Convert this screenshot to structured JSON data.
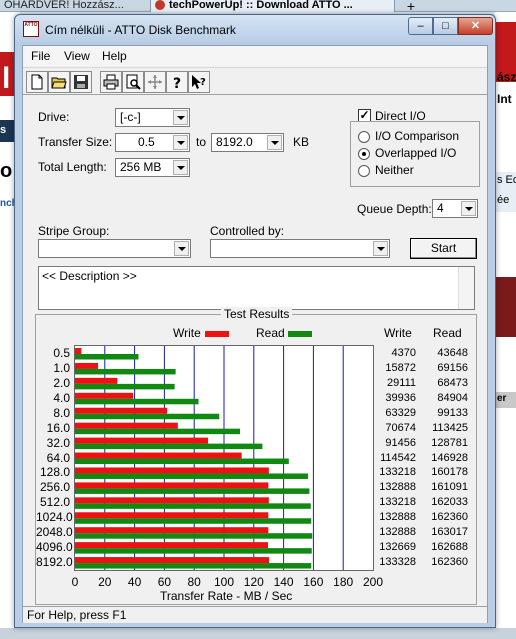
{
  "browser": {
    "tab1": "OHARDVER! Hozzász...",
    "tab2": "techPowerUp! :: Download ATTO ...",
    "tab2_close": "×",
    "new_tab": "+",
    "left_fragments": [
      "l",
      "s",
      "o",
      "nch"
    ],
    "right_fragments": [
      "ász",
      "Int",
      "s Ed",
      "ée",
      "er"
    ]
  },
  "window": {
    "title": "Cím nélküli - ATTO Disk Benchmark",
    "icon_text": "ATTO",
    "min": "–",
    "max": "□",
    "close": "✕"
  },
  "menu": [
    "File",
    "View",
    "Help"
  ],
  "toolbar": [
    "new-icon",
    "open-icon",
    "save-icon",
    "print-icon",
    "print-preview-icon",
    "move-icon",
    "help-icon",
    "context-help-icon"
  ],
  "form": {
    "drive_label": "Drive:",
    "drive_value": "[-c-]",
    "transfer_label": "Transfer Size:",
    "transfer_from": "0.5",
    "to_label": "to",
    "transfer_to": "8192.0",
    "kb_label": "KB",
    "length_label": "Total Length:",
    "length_value": "256 MB",
    "direct_io_label": "Direct I/O",
    "direct_io_checked": true,
    "radio_io_comparison": "I/O Comparison",
    "radio_overlapped": "Overlapped I/O",
    "radio_neither": "Neither",
    "radio_selected": "Overlapped I/O",
    "queue_label": "Queue Depth:",
    "queue_value": "4",
    "stripe_label": "Stripe Group:",
    "controlled_label": "Controlled by:",
    "start_label": "Start",
    "description": "<< Description >>"
  },
  "results": {
    "title": "Test Results",
    "write_label": "Write",
    "read_label": "Read",
    "col_write": "Write",
    "col_read": "Read",
    "xlabel": "Transfer Rate - MB / Sec",
    "write_color": "#ee1111",
    "read_color": "#118811"
  },
  "chart_data": {
    "type": "bar",
    "orientation": "horizontal",
    "categories": [
      "0.5",
      "1.0",
      "2.0",
      "4.0",
      "8.0",
      "16.0",
      "32.0",
      "64.0",
      "128.0",
      "256.0",
      "512.0",
      "1024.0",
      "2048.0",
      "4096.0",
      "8192.0"
    ],
    "series": [
      {
        "name": "Write",
        "values": [
          4370,
          15872,
          29111,
          39936,
          63329,
          70674,
          91456,
          114542,
          133218,
          132888,
          133218,
          132888,
          132888,
          132669,
          133328
        ]
      },
      {
        "name": "Read",
        "values": [
          43648,
          69156,
          68473,
          84904,
          99133,
          113425,
          128781,
          146928,
          160178,
          161091,
          162033,
          162360,
          163017,
          162688,
          162360
        ]
      }
    ],
    "xticks": [
      "0",
      "20",
      "40",
      "60",
      "80",
      "100",
      "120",
      "140",
      "160",
      "180",
      "200"
    ],
    "xlim": [
      0,
      200
    ],
    "xlabel": "Transfer Rate - MB / Sec",
    "grid": true
  },
  "status": "For Help, press F1"
}
